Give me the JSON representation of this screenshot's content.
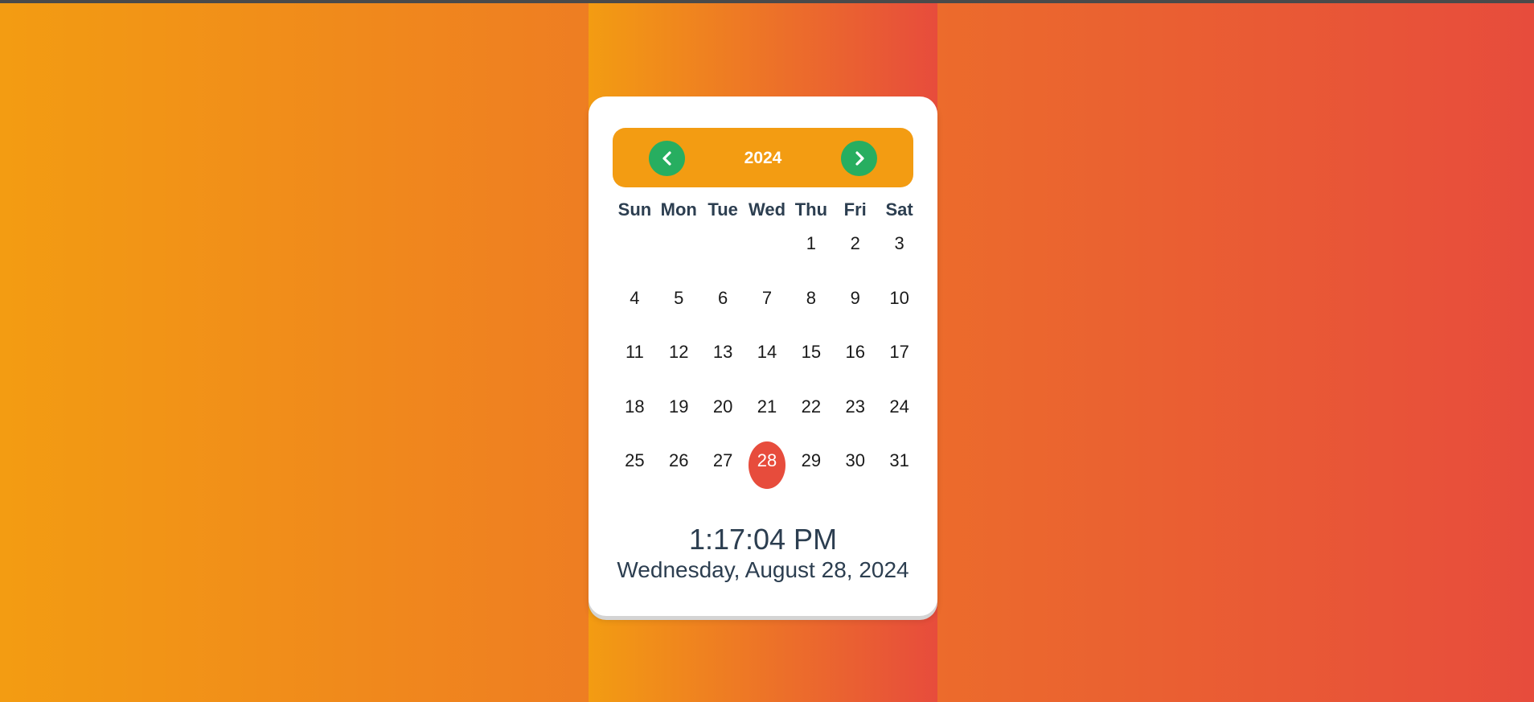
{
  "calendar": {
    "year": "2024",
    "prev_icon": "chevron-left-icon",
    "next_icon": "chevron-right-icon",
    "weekdays": [
      "Sun",
      "Mon",
      "Tue",
      "Wed",
      "Thu",
      "Fri",
      "Sat"
    ],
    "leading_empty": 4,
    "days": [
      "1",
      "2",
      "3",
      "4",
      "5",
      "6",
      "7",
      "8",
      "9",
      "10",
      "11",
      "12",
      "13",
      "14",
      "15",
      "16",
      "17",
      "18",
      "19",
      "20",
      "21",
      "22",
      "23",
      "24",
      "25",
      "26",
      "27",
      "28",
      "29",
      "30",
      "31"
    ],
    "today": "28"
  },
  "clock": {
    "time": "1:17:04 PM",
    "date": "Wednesday, August 28, 2024"
  },
  "colors": {
    "gradient_start": "#f39c12",
    "gradient_end": "#e74c3c",
    "header_bg": "#f39c12",
    "nav_button": "#27ae60",
    "today_highlight": "#e74c3c",
    "text": "#2c3e50"
  }
}
